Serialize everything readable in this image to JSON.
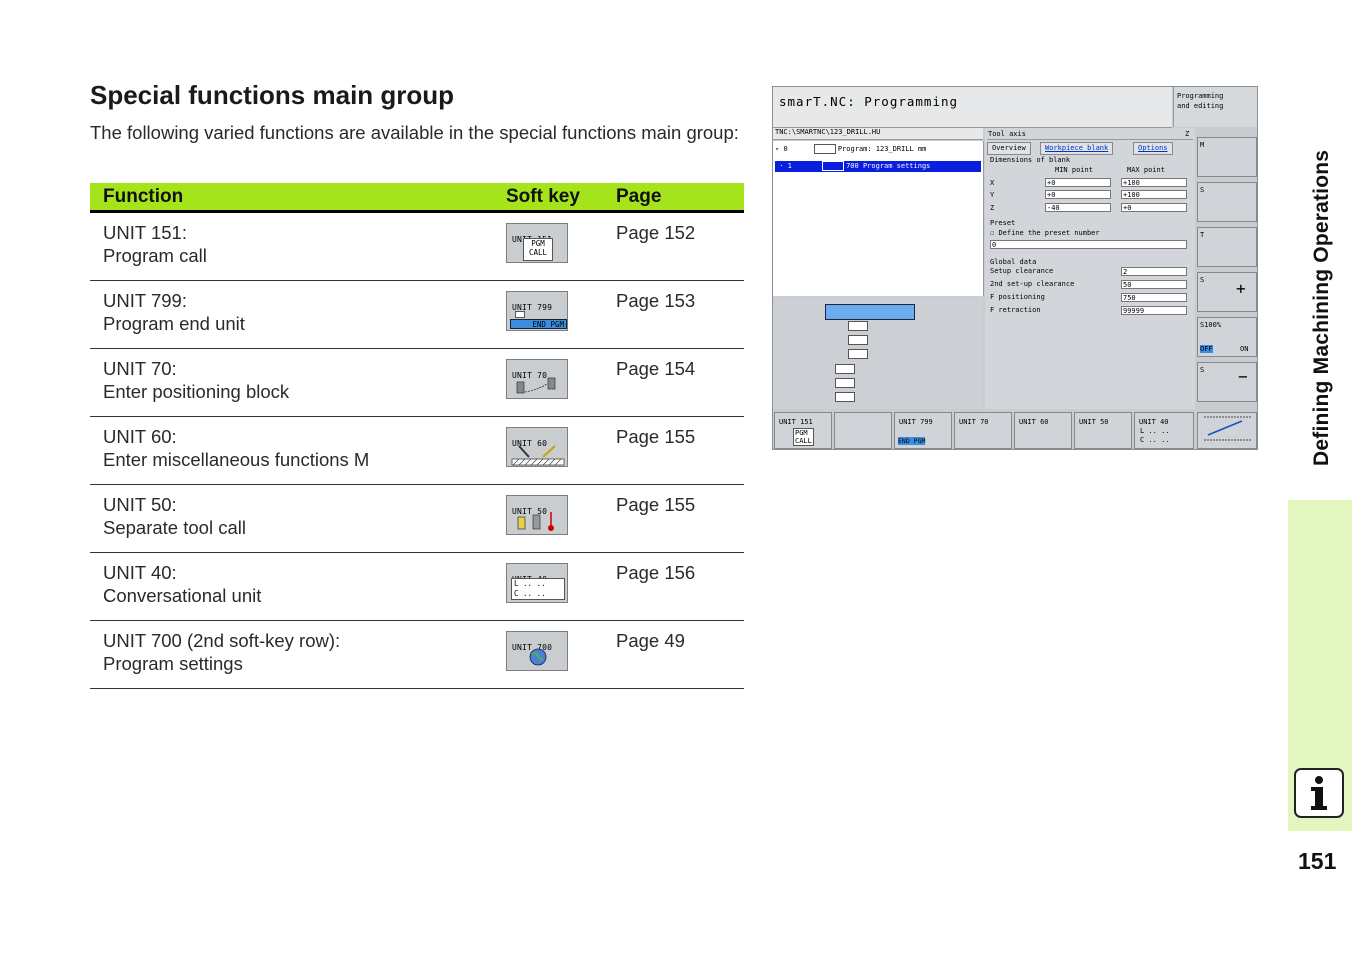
{
  "heading": "Special functions main group",
  "intro": "The following varied functions are available in the special functions main group:",
  "table": {
    "headers": {
      "function": "Function",
      "softkey": "Soft key",
      "page": "Page"
    },
    "rows": [
      {
        "unit": "UNIT 151:",
        "desc": "Program call",
        "sk_label": "UNIT 151",
        "sk_sub": [
          "PGM",
          "CALL"
        ],
        "page": "Page 152"
      },
      {
        "unit": "UNIT 799:",
        "desc": "Program end unit",
        "sk_label": "UNIT 799",
        "sk_sub": [
          "END PGM"
        ],
        "page": "Page 153"
      },
      {
        "unit": "UNIT 70:",
        "desc": "Enter positioning block",
        "sk_label": "UNIT 70",
        "sk_sub": [],
        "page": "Page 154"
      },
      {
        "unit": "UNIT 60:",
        "desc": "Enter miscellaneous functions M",
        "sk_label": "UNIT 60",
        "sk_sub": [],
        "page": "Page 155"
      },
      {
        "unit": "UNIT 50:",
        "desc": "Separate tool call",
        "sk_label": "UNIT 50",
        "sk_sub": [],
        "page": "Page 155"
      },
      {
        "unit": "UNIT 40:",
        "desc": "Conversational unit",
        "sk_label": "UNIT 40",
        "sk_sub": [
          "L .. ..",
          "C .. .."
        ],
        "page": "Page 156"
      },
      {
        "unit": "UNIT 700 (2nd soft-key row):",
        "desc": "Program settings",
        "sk_label": "UNIT 700",
        "sk_sub": [],
        "page": "Page 49"
      }
    ]
  },
  "screen": {
    "title": "smarT.NC: Programming",
    "mode": [
      "Programming",
      "and editing"
    ],
    "path": "TNC:\\SMARTNC\\123_DRILL.HU",
    "tree": [
      "0",
      "Program: 123_DRILL mm",
      "1",
      "700 Program settings"
    ],
    "axis_label": "Tool axis",
    "axis_value": "Z",
    "tabs": [
      "Overview",
      "Workpiece blank",
      "Options"
    ],
    "blank": {
      "title": "Dimensions of blank",
      "min": "MIN point",
      "max": "MAX point",
      "rows": [
        {
          "a": "X",
          "min": "+0",
          "max": "+100"
        },
        {
          "a": "Y",
          "min": "+0",
          "max": "+100"
        },
        {
          "a": "Z",
          "min": "-40",
          "max": "+0"
        }
      ]
    },
    "preset": {
      "title": "Preset",
      "check": "Define the preset number",
      "value": "0"
    },
    "global": {
      "title": "Global data",
      "rows": [
        {
          "label": "Setup clearance",
          "value": "2"
        },
        {
          "label": "2nd set-up clearance",
          "value": "50"
        },
        {
          "label": "F positioning",
          "value": "750"
        },
        {
          "label": "F retraction",
          "value": "99999"
        }
      ]
    },
    "right_softkeys": [
      "M",
      "S",
      "T",
      "S",
      "S100%",
      "S"
    ],
    "s100_off": "OFF",
    "s100_on": "ON",
    "bottom_softkeys": [
      "UNIT 151",
      "",
      "UNIT 799",
      "UNIT 70",
      "UNIT 60",
      "UNIT 50",
      "UNIT 40",
      ""
    ],
    "bottom_sub": {
      "pgm": "PGM",
      "call": "CALL",
      "endpgm": "END PGM",
      "l": "L .. ..",
      "c": "C .. .."
    }
  },
  "side_title": "Defining Machining Operations",
  "page_number": "151",
  "colors": {
    "header_green": "#a5e41b",
    "sidebar_green": "#e4f6bf",
    "selection_blue": "#0a1ee0"
  }
}
